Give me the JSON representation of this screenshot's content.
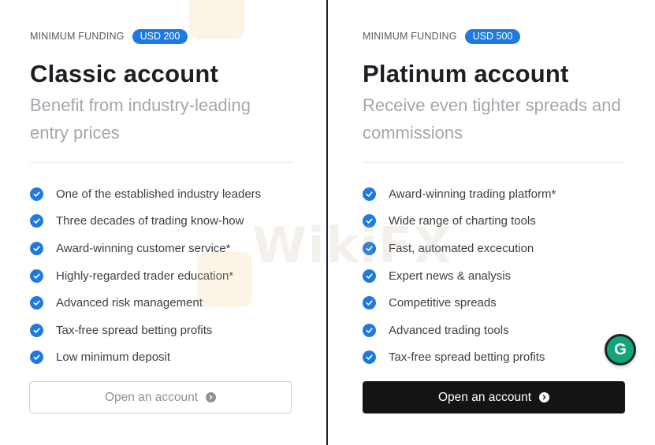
{
  "accounts": [
    {
      "funding_label": "MINIMUM FUNDING",
      "funding_amount": "USD 200",
      "title": "Classic account",
      "subtitle": "Benefit from industry-leading entry prices",
      "features": [
        "One of the established industry leaders",
        "Three decades of trading know-how",
        "Award-winning customer service*",
        "Highly-regarded trader education*",
        "Advanced risk management",
        "Tax-free spread betting profits",
        "Low minimum deposit"
      ],
      "button_label": "Open an account"
    },
    {
      "funding_label": "MINIMUM FUNDING",
      "funding_amount": "USD 500",
      "title": "Platinum account",
      "subtitle": "Receive even tighter spreads and commissions",
      "features": [
        "Award-winning trading platform*",
        "Wide range of charting tools",
        "Fast, automated excecution",
        "Expert news & analysis",
        "Competitive spreads",
        "Advanced trading tools",
        "Tax-free spread betting profits"
      ],
      "button_label": "Open an account"
    }
  ],
  "watermark": "WikiFX",
  "widget": {
    "letter": "G",
    "icon": "grammarly-icon"
  },
  "colors": {
    "accent": "#1f7ae0",
    "primary_button": "#141414",
    "widget_green": "#13a678"
  }
}
